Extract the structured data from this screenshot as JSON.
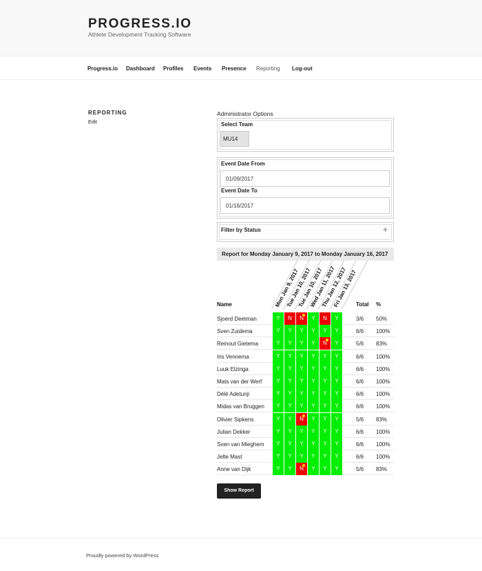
{
  "header": {
    "site_title": "PROGRESS.IO",
    "tagline": "Athlete Development Tracking Software"
  },
  "nav": {
    "items": [
      {
        "label": "Progress.io"
      },
      {
        "label": "Dashboard"
      },
      {
        "label": "Profiles"
      },
      {
        "label": "Events"
      },
      {
        "label": "Presence"
      },
      {
        "label": "Reporting",
        "current": true
      },
      {
        "label": "Log-out"
      }
    ]
  },
  "sidebar": {
    "title": "REPORTING",
    "edit": "Edit"
  },
  "admin": {
    "label": "Administrator Options",
    "select_team_label": "Select Team",
    "team_value": "MU14",
    "date_from_label": "Event Date From",
    "date_from_value": "01/09/2017",
    "date_to_label": "Event Date To",
    "date_to_value": "01/16/2017",
    "filter_label": "Filter by Status"
  },
  "report": {
    "heading": "Report for Monday January 9, 2017 to Monday January 16, 2017",
    "col_name": "Name",
    "col_total": "Total",
    "col_pct": "%",
    "dates": [
      "Mon Jan 9, 2017",
      "Tue Jan 10, 2017",
      "Tue Jan 10, 2017",
      "Wed Jan 11, 2017",
      "Thu Jan 12, 2017",
      "Fri Jan 13, 2017"
    ],
    "rows": [
      {
        "name": "Sjoerd Deetman",
        "cells": [
          "Y",
          "N",
          "N",
          "Y",
          "N",
          "Y"
        ],
        "notes": [
          false,
          false,
          true,
          false,
          false,
          false
        ],
        "total": "3/6",
        "pct": "50%"
      },
      {
        "name": "Sven Zuidema",
        "cells": [
          "Y",
          "Y",
          "Y",
          "Y",
          "Y",
          "Y"
        ],
        "notes": [
          false,
          false,
          false,
          false,
          false,
          false
        ],
        "total": "6/6",
        "pct": "100%"
      },
      {
        "name": "Reinout Gietema",
        "cells": [
          "Y",
          "Y",
          "Y",
          "Y",
          "N",
          "Y"
        ],
        "notes": [
          false,
          false,
          false,
          false,
          true,
          false
        ],
        "total": "5/6",
        "pct": "83%"
      },
      {
        "name": "Iris Vennema",
        "cells": [
          "Y",
          "Y",
          "Y",
          "Y",
          "Y",
          "Y"
        ],
        "notes": [
          false,
          false,
          false,
          false,
          false,
          false
        ],
        "total": "6/6",
        "pct": "100%"
      },
      {
        "name": "Luuk Elzinga",
        "cells": [
          "Y",
          "Y",
          "Y",
          "Y",
          "Y",
          "Y"
        ],
        "notes": [
          false,
          false,
          false,
          false,
          false,
          false
        ],
        "total": "6/6",
        "pct": "100%"
      },
      {
        "name": "Mats van der Werf",
        "cells": [
          "Y",
          "Y",
          "Y",
          "Y",
          "Y",
          "Y"
        ],
        "notes": [
          false,
          false,
          false,
          false,
          false,
          false
        ],
        "total": "6/6",
        "pct": "100%"
      },
      {
        "name": "Délé Adetunji",
        "cells": [
          "Y",
          "Y",
          "Y",
          "Y",
          "Y",
          "Y"
        ],
        "notes": [
          false,
          false,
          false,
          false,
          false,
          false
        ],
        "total": "6/6",
        "pct": "100%"
      },
      {
        "name": "Midas van Bruggen",
        "cells": [
          "Y",
          "Y",
          "Y",
          "Y",
          "Y",
          "Y"
        ],
        "notes": [
          false,
          false,
          false,
          false,
          false,
          false
        ],
        "total": "6/6",
        "pct": "100%"
      },
      {
        "name": "Olivier Sipkens",
        "cells": [
          "Y",
          "Y",
          "N",
          "Y",
          "Y",
          "Y"
        ],
        "notes": [
          false,
          false,
          true,
          false,
          false,
          false
        ],
        "total": "5/6",
        "pct": "83%"
      },
      {
        "name": "Julian Dekker",
        "cells": [
          "Y",
          "Y",
          "Y",
          "Y",
          "Y",
          "Y"
        ],
        "notes": [
          false,
          false,
          false,
          false,
          false,
          false
        ],
        "total": "6/6",
        "pct": "100%"
      },
      {
        "name": "Sven van Mieghem",
        "cells": [
          "Y",
          "Y",
          "Y",
          "Y",
          "Y",
          "Y"
        ],
        "notes": [
          false,
          false,
          false,
          false,
          false,
          false
        ],
        "total": "6/6",
        "pct": "100%"
      },
      {
        "name": "Jelte Mast",
        "cells": [
          "Y",
          "Y",
          "Y",
          "Y",
          "Y",
          "Y"
        ],
        "notes": [
          false,
          false,
          false,
          false,
          false,
          false
        ],
        "total": "6/6",
        "pct": "100%"
      },
      {
        "name": "Anne van Dijk",
        "cells": [
          "Y",
          "Y",
          "N",
          "Y",
          "Y",
          "Y"
        ],
        "notes": [
          false,
          false,
          true,
          false,
          false,
          false
        ],
        "total": "5/6",
        "pct": "83%"
      }
    ],
    "colors": {
      "present": "#00ee00",
      "absent": "#ee0000",
      "note_dot": "#ffd200"
    }
  },
  "show_report_label": "Show Report",
  "footer": {
    "text": "Proudly powered by WordPress"
  }
}
